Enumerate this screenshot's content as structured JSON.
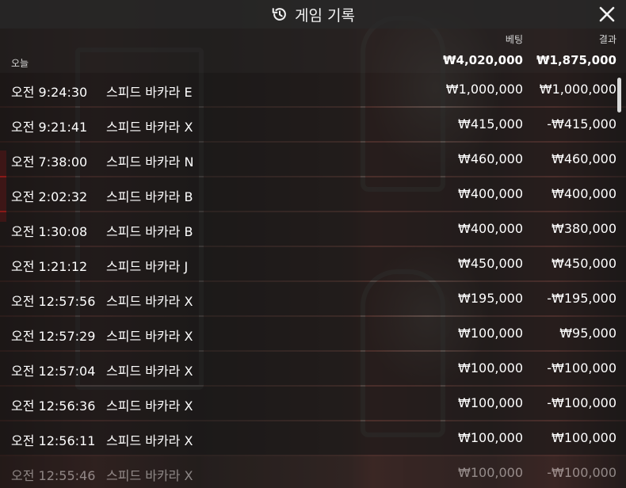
{
  "header": {
    "title": "게임 기록",
    "icon": "history-icon",
    "close_icon": "close-icon"
  },
  "columns": {
    "bet": "베팅",
    "result": "결과"
  },
  "summary": {
    "label": "오늘",
    "total_bet": "₩4,020,000",
    "total_result": "₩1,875,000"
  },
  "rows": [
    {
      "time": "오전 9:24:30",
      "game": "스피드 바카라 E",
      "bet": "₩1,000,000",
      "result": "₩1,000,000"
    },
    {
      "time": "오전 9:21:41",
      "game": "스피드 바카라 X",
      "bet": "₩415,000",
      "result": "-₩415,000"
    },
    {
      "time": "오전 7:38:00",
      "game": "스피드 바카라 N",
      "bet": "₩460,000",
      "result": "₩460,000"
    },
    {
      "time": "오전 2:02:32",
      "game": "스피드 바카라 B",
      "bet": "₩400,000",
      "result": "₩400,000"
    },
    {
      "time": "오전 1:30:08",
      "game": "스피드 바카라 B",
      "bet": "₩400,000",
      "result": "₩380,000"
    },
    {
      "time": "오전 1:21:12",
      "game": "스피드 바카라 J",
      "bet": "₩450,000",
      "result": "₩450,000"
    },
    {
      "time": "오전 12:57:56",
      "game": "스피드 바카라 X",
      "bet": "₩195,000",
      "result": "-₩195,000"
    },
    {
      "time": "오전 12:57:29",
      "game": "스피드 바카라 X",
      "bet": "₩100,000",
      "result": "₩95,000"
    },
    {
      "time": "오전 12:57:04",
      "game": "스피드 바카라 X",
      "bet": "₩100,000",
      "result": "-₩100,000"
    },
    {
      "time": "오전 12:56:36",
      "game": "스피드 바카라 X",
      "bet": "₩100,000",
      "result": "-₩100,000"
    },
    {
      "time": "오전 12:56:11",
      "game": "스피드 바카라 X",
      "bet": "₩100,000",
      "result": "₩100,000"
    },
    {
      "time": "오전 12:55:46",
      "game": "스피드 바카라 X",
      "bet": "₩100,000",
      "result": "-₩100,000"
    }
  ]
}
